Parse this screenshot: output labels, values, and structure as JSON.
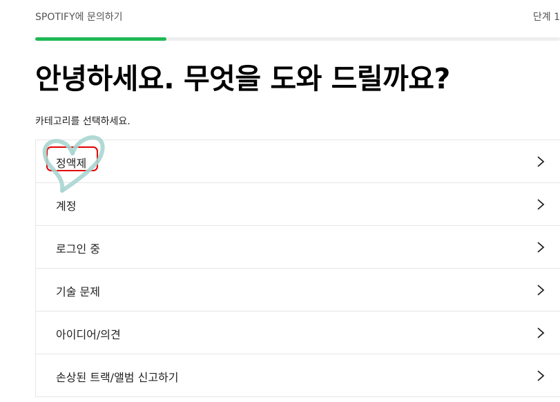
{
  "header": {
    "breadcrumb": "SPOTIFY에 문의하기",
    "step": "단계 1"
  },
  "progress": {
    "fraction": 0.25,
    "color": "#1db954"
  },
  "title": "안녕하세요. 무엇을 도와 드릴까요?",
  "instruction": "카테고리를 선택하세요.",
  "categories": [
    {
      "label": "정액제"
    },
    {
      "label": "계정"
    },
    {
      "label": "로그인 중"
    },
    {
      "label": "기술 문제"
    },
    {
      "label": "아이디어/의견"
    },
    {
      "label": "손상된 트랙/앨범 신고하기"
    }
  ],
  "icons": {
    "row_chevron": "chevron-right-icon"
  },
  "annotations": {
    "highlight_color": "#e00000",
    "doodle_color": "#a8d5d0",
    "doodle_shape": "heart"
  }
}
